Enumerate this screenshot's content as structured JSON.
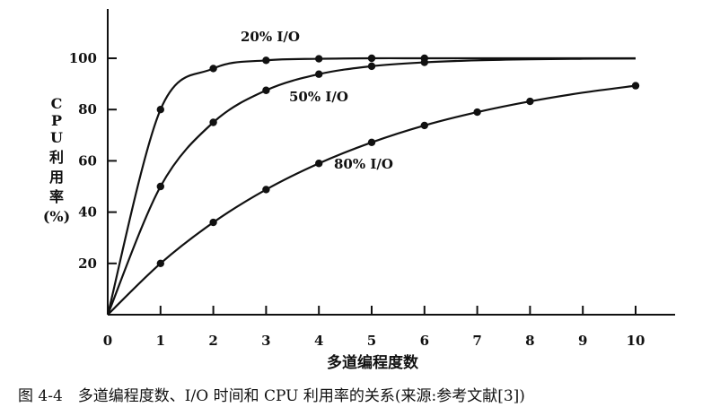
{
  "chart_data": {
    "type": "line",
    "title": "",
    "xlabel": "多道编程度数",
    "ylabel_lines": [
      "C",
      "P",
      "U",
      "利",
      "用",
      "率",
      "(%)"
    ],
    "xlim": [
      0,
      10.6
    ],
    "ylim": [
      0,
      115
    ],
    "x_ticks": [
      0,
      1,
      2,
      3,
      4,
      5,
      6,
      7,
      8,
      9,
      10
    ],
    "y_ticks": [
      20,
      40,
      60,
      80,
      100
    ],
    "grid": false,
    "series": [
      {
        "name": "20% I/O",
        "x": [
          0,
          1,
          2,
          3,
          4,
          5,
          6,
          7,
          8,
          9,
          10
        ],
        "y": [
          0,
          80,
          96,
          99.2,
          99.8,
          100,
          100,
          100,
          100,
          100,
          100
        ],
        "markers": [
          1,
          2,
          3,
          4,
          5,
          6
        ]
      },
      {
        "name": "50% I/O",
        "x": [
          0,
          1,
          2,
          3,
          4,
          5,
          6,
          7,
          8,
          9,
          10
        ],
        "y": [
          0,
          50,
          75,
          87.5,
          93.8,
          96.9,
          98.4,
          99.2,
          99.6,
          99.8,
          99.9
        ],
        "markers": [
          1,
          2,
          3,
          4,
          5,
          6
        ]
      },
      {
        "name": "80% I/O",
        "x": [
          0,
          1,
          2,
          3,
          4,
          5,
          6,
          7,
          8,
          9,
          10
        ],
        "y": [
          0,
          20,
          36,
          48.8,
          59,
          67.2,
          73.8,
          79,
          83.2,
          86.6,
          89.3
        ],
        "markers": [
          1,
          2,
          3,
          4,
          5,
          6,
          7,
          8,
          10
        ]
      }
    ],
    "caption": "图 4-4　多道编程度数、I/O 时间和 CPU 利用率的关系(来源:参考文献[3])"
  }
}
